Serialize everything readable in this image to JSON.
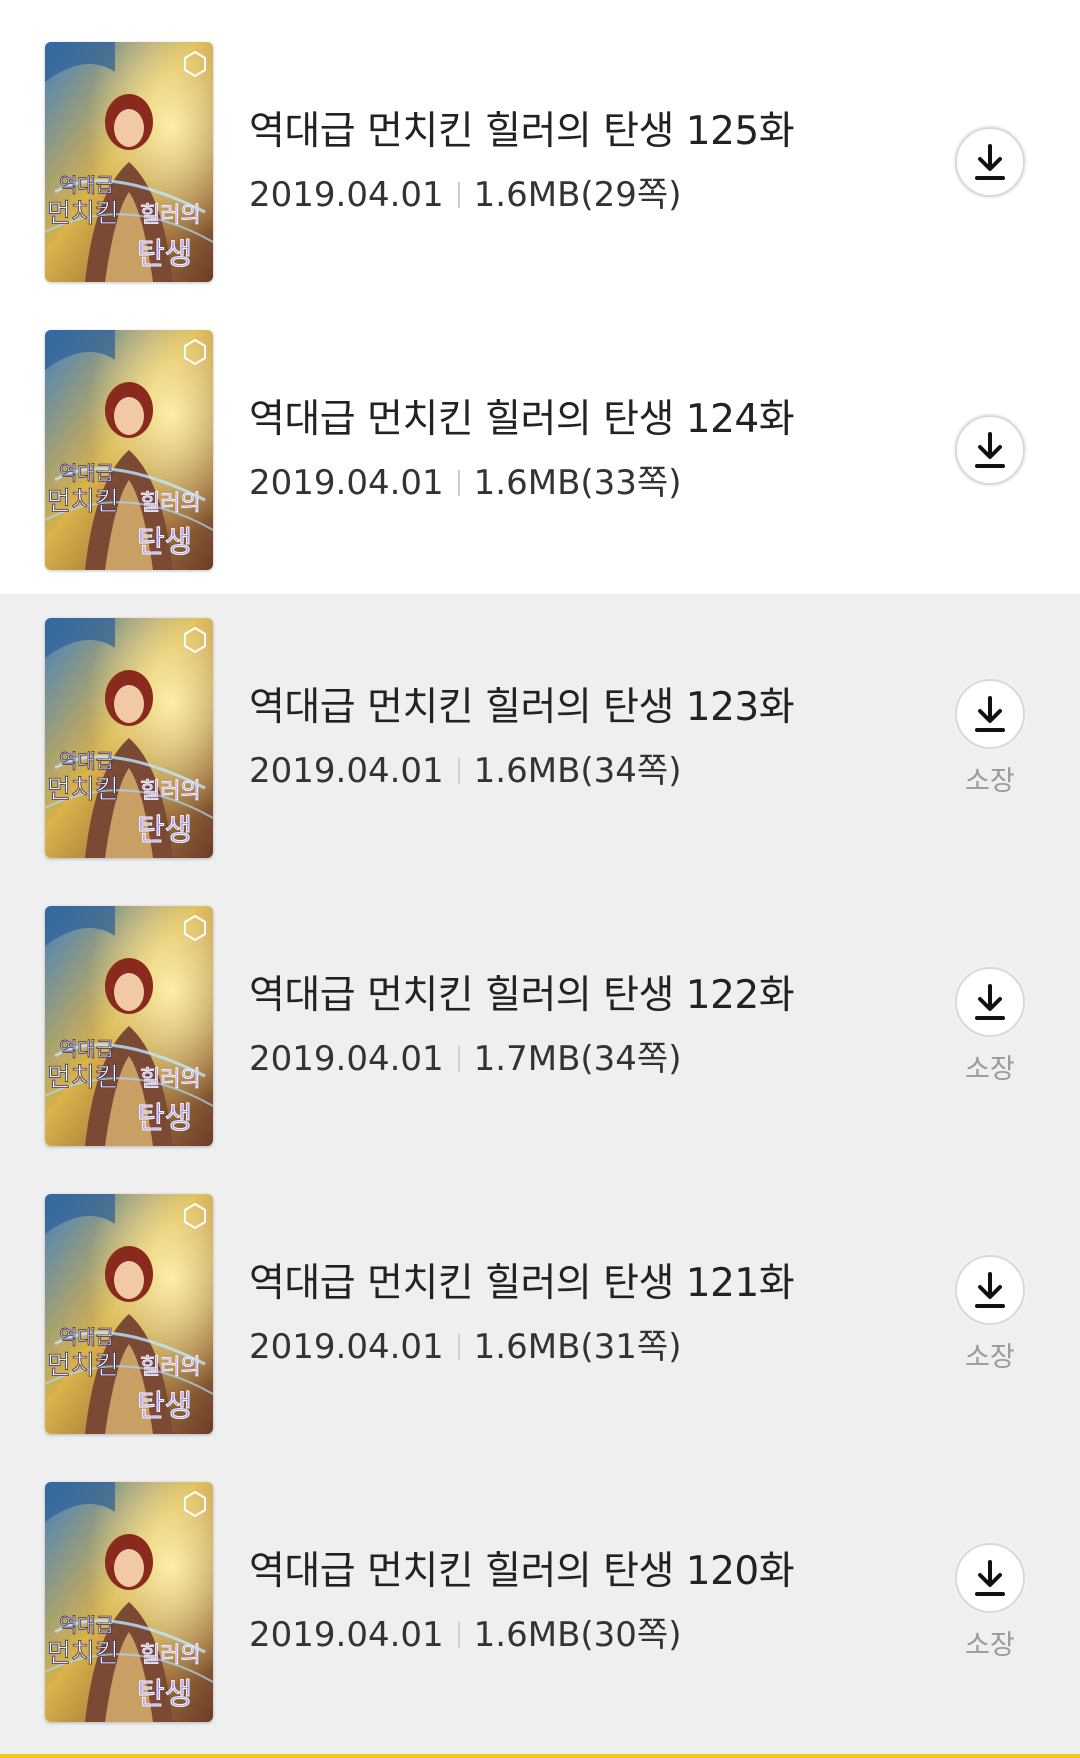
{
  "episodes": [
    {
      "cover_title": "역대급 먼치킨 힐러의 탄생",
      "title": "역대급 먼치킨 힐러의 탄생 125화",
      "date": "2019.04.01",
      "size": "1.6MB(29쪽)",
      "owned_label": ""
    },
    {
      "cover_title": "역대급 먼치킨 힐러의 탄생",
      "title": "역대급 먼치킨 힐러의 탄생 124화",
      "date": "2019.04.01",
      "size": "1.6MB(33쪽)",
      "owned_label": ""
    },
    {
      "cover_title": "역대급 먼치킨 힐러의 탄생",
      "title": "역대급 먼치킨 힐러의 탄생 123화",
      "date": "2019.04.01",
      "size": "1.6MB(34쪽)",
      "owned_label": "소장"
    },
    {
      "cover_title": "역대급 먼치킨 힐러의 탄생",
      "title": "역대급 먼치킨 힐러의 탄생 122화",
      "date": "2019.04.01",
      "size": "1.7MB(34쪽)",
      "owned_label": "소장"
    },
    {
      "cover_title": "역대급 먼치킨 힐러의 탄생",
      "title": "역대급 먼치킨 힐러의 탄생 121화",
      "date": "2019.04.01",
      "size": "1.6MB(31쪽)",
      "owned_label": "소장"
    },
    {
      "cover_title": "역대급 먼치킨 힐러의 탄생",
      "title": "역대급 먼치킨 힐러의 탄생 120화",
      "date": "2019.04.01",
      "size": "1.6MB(30쪽)",
      "owned_label": "소장"
    }
  ],
  "icons": {
    "download": "download-arrow-icon"
  },
  "colors": {
    "accent_bar": "#f5c518",
    "owned_bg": "#efefef",
    "unowned_bg": "#ffffff"
  }
}
